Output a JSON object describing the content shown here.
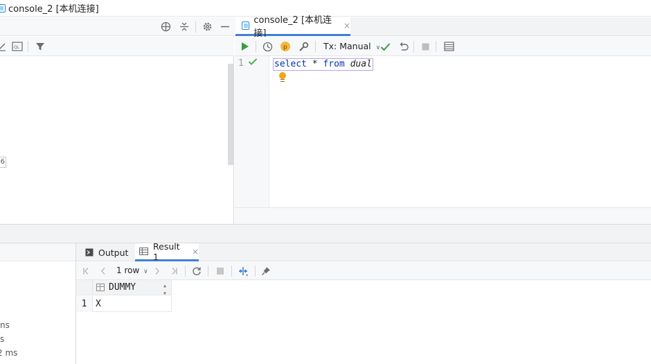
{
  "window": {
    "title": "console_2 [本机连接]"
  },
  "left_panel": {
    "badge_number": "6"
  },
  "editor": {
    "tab_label": "console_2 [本机连接]",
    "tab_close": "×",
    "toolbar": {
      "tx_mode": "Tx: Manual",
      "profile_badge": "p"
    },
    "line_number": "1",
    "code": {
      "kw1": "select",
      "op": "*",
      "kw2": "from",
      "ident": "dual"
    }
  },
  "bottom_left": {
    "lines": [
      "ns",
      "s",
      "2 ms"
    ]
  },
  "results": {
    "tabs": [
      {
        "label": "Output"
      },
      {
        "label": "Result 1",
        "close": "×"
      }
    ],
    "toolbar": {
      "row_count": "1 row"
    },
    "grid": {
      "columns": [
        "DUMMY"
      ],
      "rows": [
        {
          "num": "1",
          "values": [
            "X"
          ]
        }
      ]
    }
  },
  "colors": {
    "accent": "#3d7fd9",
    "keyword": "#0033b3",
    "success": "#4caf50",
    "bulb": "#f2a516"
  }
}
